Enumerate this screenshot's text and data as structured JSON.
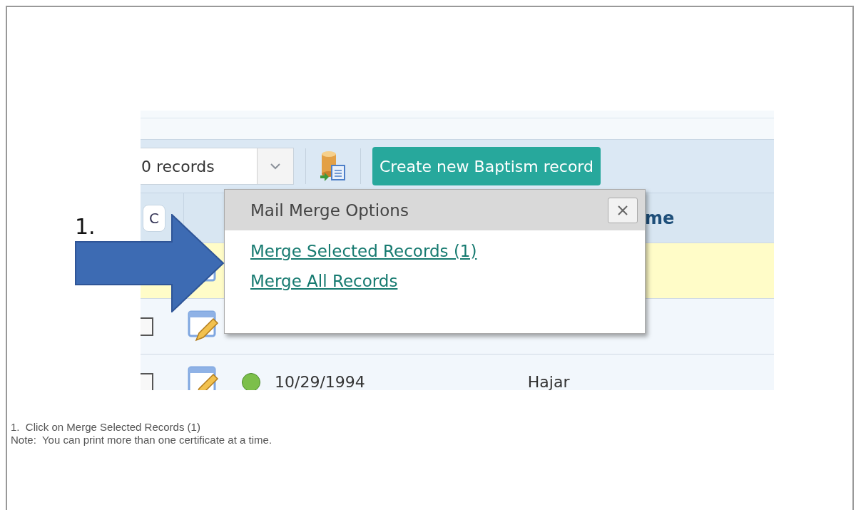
{
  "toolbar": {
    "records_select": {
      "value": "0 records"
    },
    "create_button": "Create new Baptism record"
  },
  "table": {
    "header": {
      "column_1": "C",
      "column_5": "me"
    },
    "rows": [
      {
        "selected": true
      },
      {
        "selected": false,
        "checked": false
      },
      {
        "selected": false,
        "checked": false,
        "color": "#7cbf4a",
        "date": "10/29/1994",
        "name": "Hajar"
      }
    ]
  },
  "popup": {
    "title": "Mail Merge Options",
    "links": [
      "Merge Selected Records (1)",
      "Merge All Records"
    ]
  },
  "callout": {
    "label": "1."
  },
  "instructions": [
    "1.  Click on Merge Selected Records (1)",
    "Note:  You can print more than one certificate at a time."
  ]
}
